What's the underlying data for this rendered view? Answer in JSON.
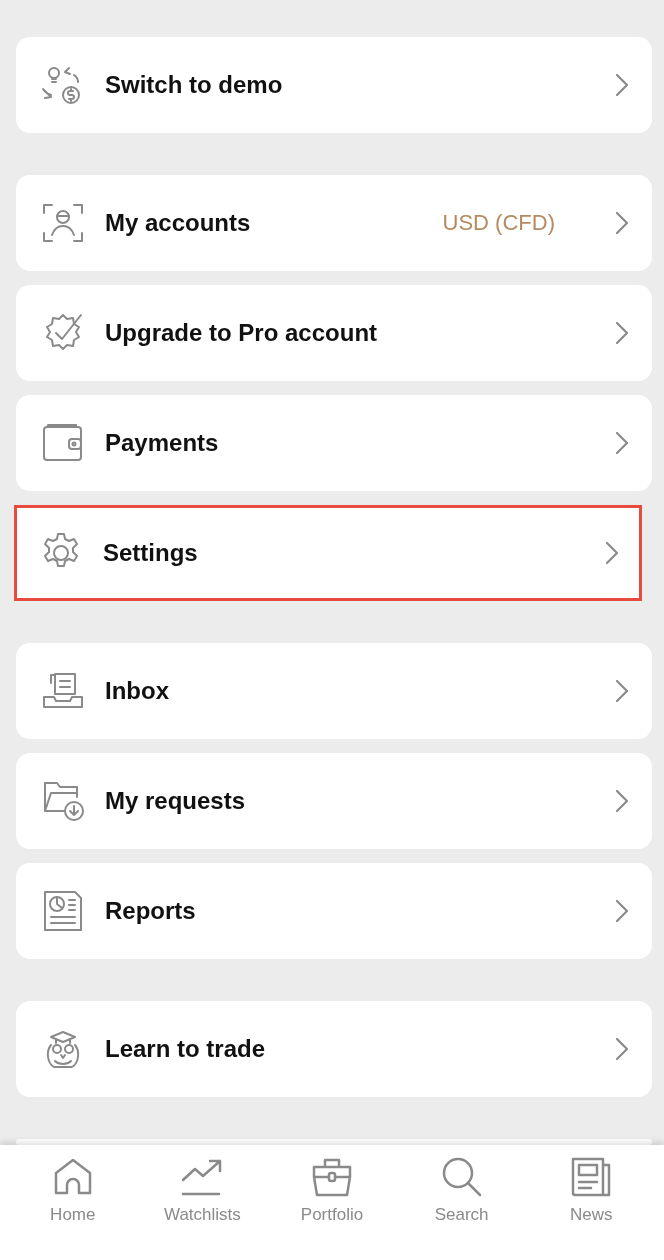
{
  "menu_groups": [
    {
      "items": [
        {
          "label": "Switch to demo",
          "highlighted": false
        }
      ]
    },
    {
      "items": [
        {
          "label": "My accounts",
          "value": "USD (CFD)",
          "highlighted": false
        },
        {
          "label": "Upgrade to Pro account",
          "highlighted": false
        },
        {
          "label": "Payments",
          "highlighted": false
        },
        {
          "label": "Settings",
          "highlighted": true
        }
      ]
    },
    {
      "items": [
        {
          "label": "Inbox",
          "highlighted": false
        },
        {
          "label": "My requests",
          "highlighted": false
        },
        {
          "label": "Reports",
          "highlighted": false
        }
      ]
    },
    {
      "items": [
        {
          "label": "Learn to trade",
          "highlighted": false
        }
      ]
    }
  ],
  "bottom_nav": [
    {
      "label": "Home"
    },
    {
      "label": "Watchlists"
    },
    {
      "label": "Portfolio"
    },
    {
      "label": "Search"
    },
    {
      "label": "News"
    }
  ]
}
